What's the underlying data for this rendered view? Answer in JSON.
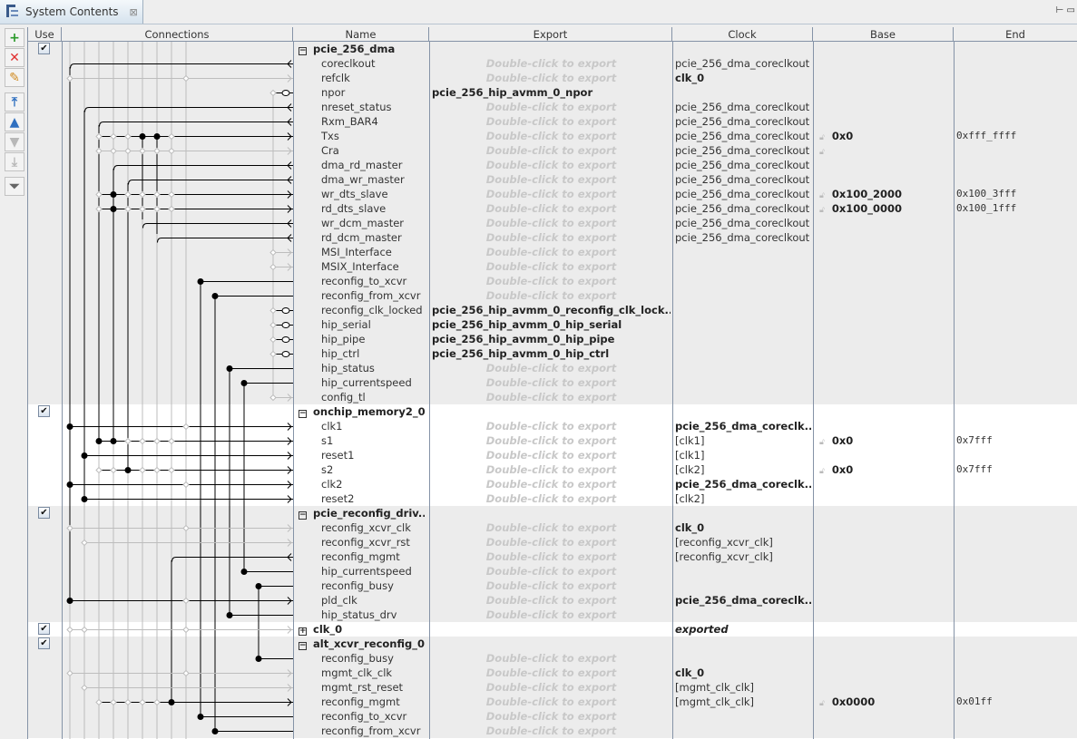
{
  "tab": {
    "title": "System Contents",
    "icon": "system-contents-icon",
    "close": "⊠"
  },
  "toolbar": [
    {
      "name": "add-button",
      "glyph": "+",
      "color": "#2a9a2a"
    },
    {
      "name": "remove-button",
      "glyph": "✕",
      "color": "#e03030"
    },
    {
      "name": "edit-button",
      "glyph": "✎",
      "color": "#d08a20"
    },
    {
      "name": "move-top-button",
      "glyph": "⤒",
      "color": "#3070c0"
    },
    {
      "name": "move-up-button",
      "glyph": "▲",
      "color": "#3070c0"
    },
    {
      "name": "move-down-button",
      "glyph": "▼",
      "color": "#b8b8b8"
    },
    {
      "name": "move-bottom-button",
      "glyph": "⤓",
      "color": "#b8b8b8"
    },
    {
      "name": "filter-button",
      "glyph": "⏷",
      "color": "#666"
    }
  ],
  "columns": [
    "Use",
    "Connections",
    "Name",
    "Export",
    "Clock",
    "Base",
    "End"
  ],
  "export_hint": "Double-click to export",
  "rows": [
    {
      "kind": "group",
      "name": "pcie_256_dma",
      "use": true,
      "toggle": "−"
    },
    {
      "name": "coreclkout",
      "clock": "pcie_256_dma_coreclkout"
    },
    {
      "name": "refclk",
      "clock": "clk_0",
      "clock_bold": true
    },
    {
      "name": "npor",
      "export": "pcie_256_hip_avmm_0_npor"
    },
    {
      "name": "nreset_status",
      "clock": "pcie_256_dma_coreclkout"
    },
    {
      "name": "Rxm_BAR4",
      "clock": "pcie_256_dma_coreclkout"
    },
    {
      "name": "Txs",
      "clock": "pcie_256_dma_coreclkout",
      "locked": true,
      "base": "0x0",
      "end": "0xfff_ffff"
    },
    {
      "name": "Cra",
      "clock": "pcie_256_dma_coreclkout",
      "locked": true
    },
    {
      "name": "dma_rd_master",
      "clock": "pcie_256_dma_coreclkout"
    },
    {
      "name": "dma_wr_master",
      "clock": "pcie_256_dma_coreclkout"
    },
    {
      "name": "wr_dts_slave",
      "clock": "pcie_256_dma_coreclkout",
      "locked": true,
      "base": "0x100_2000",
      "end": "0x100_3fff"
    },
    {
      "name": "rd_dts_slave",
      "clock": "pcie_256_dma_coreclkout",
      "locked": true,
      "base": "0x100_0000",
      "end": "0x100_1fff"
    },
    {
      "name": "wr_dcm_master",
      "clock": "pcie_256_dma_coreclkout"
    },
    {
      "name": "rd_dcm_master",
      "clock": "pcie_256_dma_coreclkout"
    },
    {
      "name": "MSI_Interface"
    },
    {
      "name": "MSIX_Interface"
    },
    {
      "name": "reconfig_to_xcvr"
    },
    {
      "name": "reconfig_from_xcvr"
    },
    {
      "name": "reconfig_clk_locked",
      "export": "pcie_256_hip_avmm_0_reconfig_clk_lock..."
    },
    {
      "name": "hip_serial",
      "export": "pcie_256_hip_avmm_0_hip_serial"
    },
    {
      "name": "hip_pipe",
      "export": "pcie_256_hip_avmm_0_hip_pipe"
    },
    {
      "name": "hip_ctrl",
      "export": "pcie_256_hip_avmm_0_hip_ctrl"
    },
    {
      "name": "hip_status"
    },
    {
      "name": "hip_currentspeed"
    },
    {
      "name": "config_tl"
    },
    {
      "kind": "group",
      "name": "onchip_memory2_0",
      "use": true,
      "toggle": "−"
    },
    {
      "name": "clk1",
      "clock": "pcie_256_dma_coreclk...",
      "clock_bold": true
    },
    {
      "name": "s1",
      "clock": "[clk1]",
      "locked": true,
      "base": "0x0",
      "end": "0x7fff"
    },
    {
      "name": "reset1",
      "clock": "[clk1]"
    },
    {
      "name": "s2",
      "clock": "[clk2]",
      "locked": true,
      "base": "0x0",
      "end": "0x7fff"
    },
    {
      "name": "clk2",
      "clock": "pcie_256_dma_coreclk...",
      "clock_bold": true
    },
    {
      "name": "reset2",
      "clock": "[clk2]"
    },
    {
      "kind": "group",
      "name": "pcie_reconfig_driv...",
      "use": true,
      "toggle": "−"
    },
    {
      "name": "reconfig_xcvr_clk",
      "clock": "clk_0",
      "clock_bold": true
    },
    {
      "name": "reconfig_xcvr_rst",
      "clock": "[reconfig_xcvr_clk]"
    },
    {
      "name": "reconfig_mgmt",
      "clock": "[reconfig_xcvr_clk]"
    },
    {
      "name": "hip_currentspeed"
    },
    {
      "name": "reconfig_busy"
    },
    {
      "name": "pld_clk",
      "clock": "pcie_256_dma_coreclk...",
      "clock_bold": true
    },
    {
      "name": "hip_status_drv"
    },
    {
      "kind": "group",
      "name": "clk_0",
      "use": true,
      "toggle": "+",
      "export_text": "exported"
    },
    {
      "kind": "group",
      "name": "alt_xcvr_reconfig_0",
      "use": true,
      "toggle": "−"
    },
    {
      "name": "reconfig_busy"
    },
    {
      "name": "mgmt_clk_clk",
      "clock": "clk_0",
      "clock_bold": true
    },
    {
      "name": "mgmt_rst_reset",
      "clock": "[mgmt_clk_clk]"
    },
    {
      "name": "reconfig_mgmt",
      "clock": "[mgmt_clk_clk]",
      "locked": true,
      "base": "0x0000",
      "end": "0x01ff"
    },
    {
      "name": "reconfig_to_xcvr"
    },
    {
      "name": "reconfig_from_xcvr"
    }
  ]
}
